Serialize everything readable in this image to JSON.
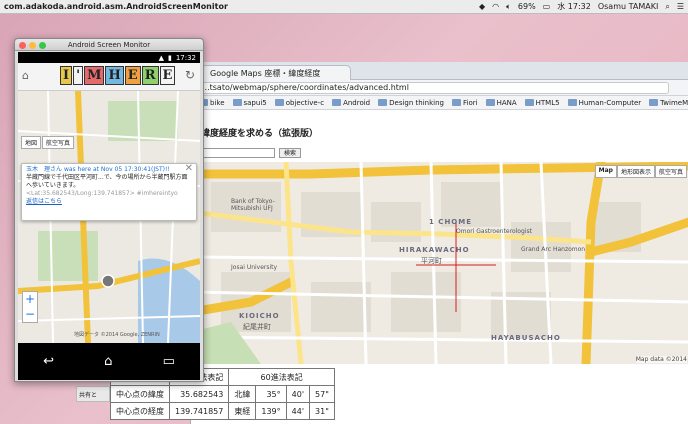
{
  "menubar": {
    "app_title": "com.adakoda.android.asm.AndroidScreenMonitor",
    "battery": "69%",
    "clock": "水 17:32",
    "user": "Osamu TAMAKI"
  },
  "monitor": {
    "title": "Android Screen Monitor",
    "phone_time": "17:32",
    "logo_letters": [
      "I",
      "'",
      "M",
      "H",
      "E",
      "R",
      "E"
    ],
    "map_buttons": [
      "地図",
      "航空写真"
    ],
    "popup": {
      "name": "玉木　理さん",
      "meta": "was here at Nov 05 17:30:41(JST)!!",
      "message": "半蔵門線で千代田区平河町...で、今の場所から半蔵門駅方面へ歩いていきます。",
      "coords": "<Lat:35.682543/Long:139.741857> #imhereintyo",
      "reply": "返信はこちら"
    },
    "copyright": "地図データ ©2014 Google, ZENRIN"
  },
  "browser": {
    "tab_title": "Google Maps 座標・緯度経度",
    "url": "...tsato/webmap/sphere/coordinates/advanced.html",
    "bookmarks": [
      "bike",
      "sapui5",
      "objective-c",
      "Android",
      "Design thinking",
      "Fiori",
      "HANA",
      "HTML5",
      "Human-Computer",
      "TwimeMachine"
    ],
    "page_heading": "緯度経度を求める（拡張版）",
    "search_button": "検索",
    "map_types": [
      "Map",
      "地形図表示",
      "航空写真"
    ],
    "map_copyright": "Map data ©2014",
    "map_labels": {
      "district_hirakawa": "HIRAKAWACHO",
      "district_hirakawa_jp": "平河町",
      "district_kioicho": "KIOICHO",
      "district_kioicho_jp": "紀尾井町",
      "district_hayabusa": "HAYABUSACHO",
      "district_1chome": "1 CHOME",
      "bank": "Bank of Tokyo-Mitsubishi UFJ",
      "school": "Josai University",
      "restaurant": "Omori Gastroenterologist",
      "hotel": "Grand Arc Hanzomon"
    }
  },
  "table": {
    "header_left": "十進法表記",
    "header_right": "60進法表記",
    "rows": [
      {
        "label": "中心点の緯度",
        "decimal": "35.682543",
        "dir": "北緯",
        "deg": "35°",
        "min": "40'",
        "sec": "57\""
      },
      {
        "label": "中心点の経度",
        "decimal": "139.741857",
        "dir": "東経",
        "deg": "139°",
        "min": "44'",
        "sec": "31\""
      }
    ],
    "stub_text": "共有と"
  }
}
